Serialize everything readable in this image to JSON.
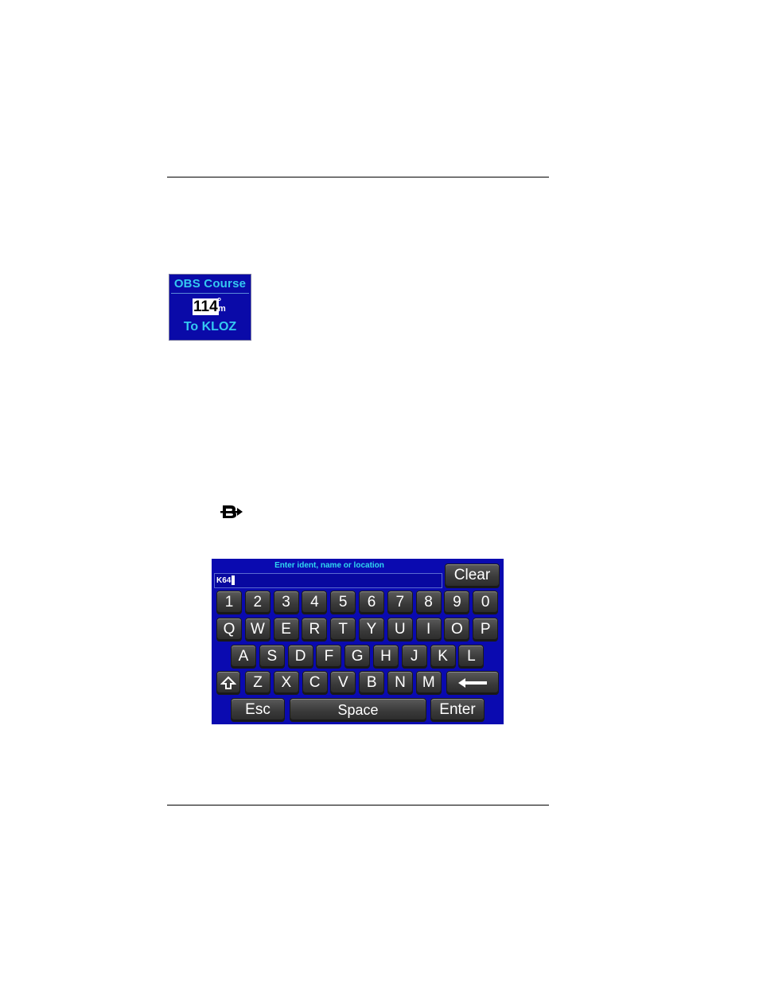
{
  "obs_widget": {
    "title": "OBS Course",
    "course_value": "114",
    "degree_symbol": "°",
    "unit": "m",
    "to_label": "To KLOZ"
  },
  "direct_to_icon": "direct-to-icon",
  "keyboard": {
    "prompt": "Enter ident, name or location",
    "input_value": "K64",
    "clear_label": "Clear",
    "row_numbers": [
      "1",
      "2",
      "3",
      "4",
      "5",
      "6",
      "7",
      "8",
      "9",
      "0"
    ],
    "row_qwerty": [
      "Q",
      "W",
      "E",
      "R",
      "T",
      "Y",
      "U",
      "I",
      "O",
      "P"
    ],
    "row_asdf": [
      "A",
      "S",
      "D",
      "F",
      "G",
      "H",
      "J",
      "K",
      "L"
    ],
    "row_zxcv": [
      "Z",
      "X",
      "C",
      "V",
      "B",
      "N",
      "M"
    ],
    "shift_icon": "shift-arrow-icon",
    "backspace_icon": "backspace-arrow-icon",
    "esc_label": "Esc",
    "space_label": "Space",
    "enter_label": "Enter"
  },
  "colors": {
    "panel_bg": "#0a0ab0",
    "accent_cyan": "#30d8f0",
    "key_bg": "#3a3a3a"
  }
}
